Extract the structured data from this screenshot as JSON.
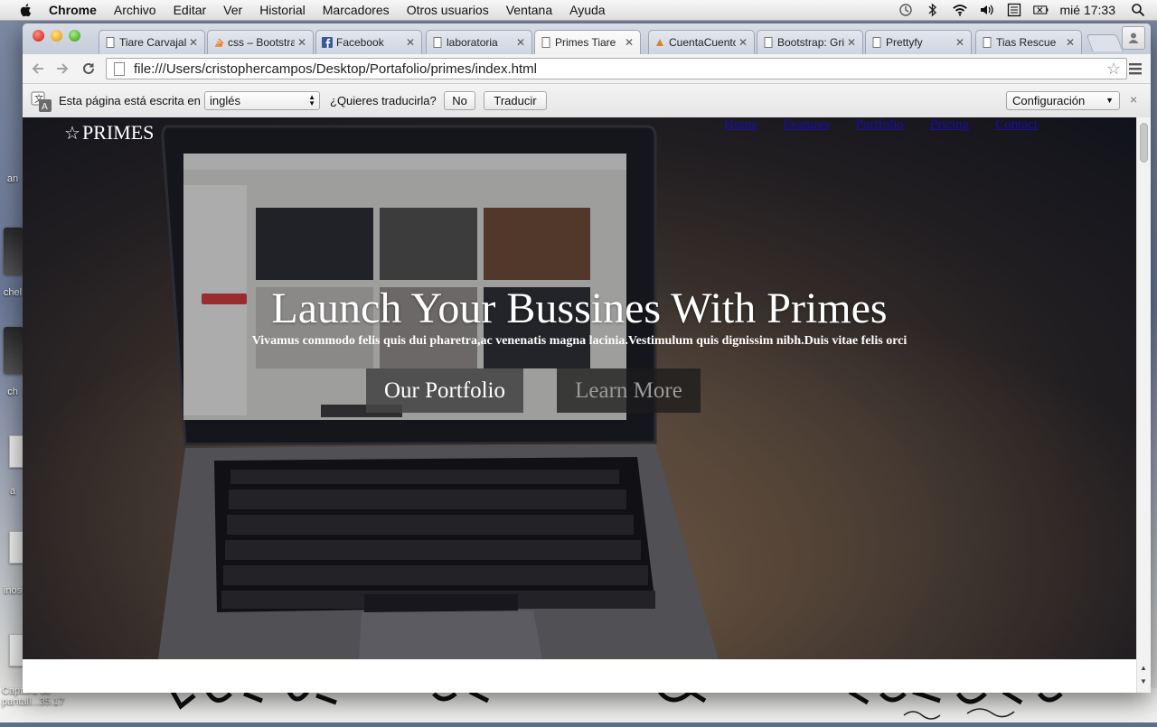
{
  "menubar": {
    "app_name": "Chrome",
    "items": [
      "Archivo",
      "Editar",
      "Ver",
      "Historial",
      "Marcadores",
      "Otros usuarios",
      "Ventana",
      "Ayuda"
    ],
    "clock": "mié 17:33",
    "tray_icons": [
      "time-machine-icon",
      "bluetooth-icon",
      "wifi-icon",
      "volume-icon",
      "keyboard-input-icon",
      "battery-icon",
      "spotlight-icon"
    ]
  },
  "desktop": {
    "screenshot_label_line1": "Captura de",
    "screenshot_label_line2": "pantall...35.17",
    "icon_labels": [
      "an",
      "chel",
      "ch",
      "a",
      "inos"
    ]
  },
  "tabs": [
    {
      "title": "Tiare Carvajal",
      "favicon": "page-icon",
      "active": false
    },
    {
      "title": "css – Bootstrap",
      "favicon": "stackoverflow-icon",
      "active": false
    },
    {
      "title": "Facebook",
      "favicon": "facebook-icon",
      "active": false
    },
    {
      "title": "laboratoria",
      "favicon": "page-icon",
      "active": false
    },
    {
      "title": "Primes Tiare",
      "favicon": "page-icon",
      "active": true
    },
    {
      "title": "CuentaCuentos",
      "favicon": "cuentacuentos-icon",
      "active": false
    },
    {
      "title": "Bootstrap: Grid",
      "favicon": "page-icon",
      "active": false
    },
    {
      "title": "Prettyfy",
      "favicon": "page-icon",
      "active": false
    },
    {
      "title": "Tias Rescue",
      "favicon": "page-icon",
      "active": false
    }
  ],
  "address_bar": {
    "url": "file:///Users/cristophercampos/Desktop/Portafolio/primes/index.html"
  },
  "translate_bar": {
    "prefix": "Esta página está escrita en",
    "language": "inglés",
    "question": "¿Quieres traducirla?",
    "no_label": "No",
    "translate_label": "Traducir",
    "config_label": "Configuración",
    "close_label": "×"
  },
  "page": {
    "brand": "PRIMES",
    "brand_icon": "star-icon",
    "nav": [
      "Home",
      "Features",
      "Portfolio",
      "Pricing",
      "Contact"
    ],
    "hero_title": "Launch Your Bussines With Primes",
    "hero_subtitle": "Vivamus commodo felis quis dui pharetra,ac venenatis magna lacinia.Vestimulum quis dignissim nibh.Duis vitae felis orci",
    "button_primary": "Our Portfolio",
    "button_secondary": "Learn More"
  },
  "colors": {
    "link": "#1a0dab",
    "hero_text": "#ffffff",
    "primary_button_bg": "#464646",
    "secondary_button_bg": "#1c1c1c"
  }
}
